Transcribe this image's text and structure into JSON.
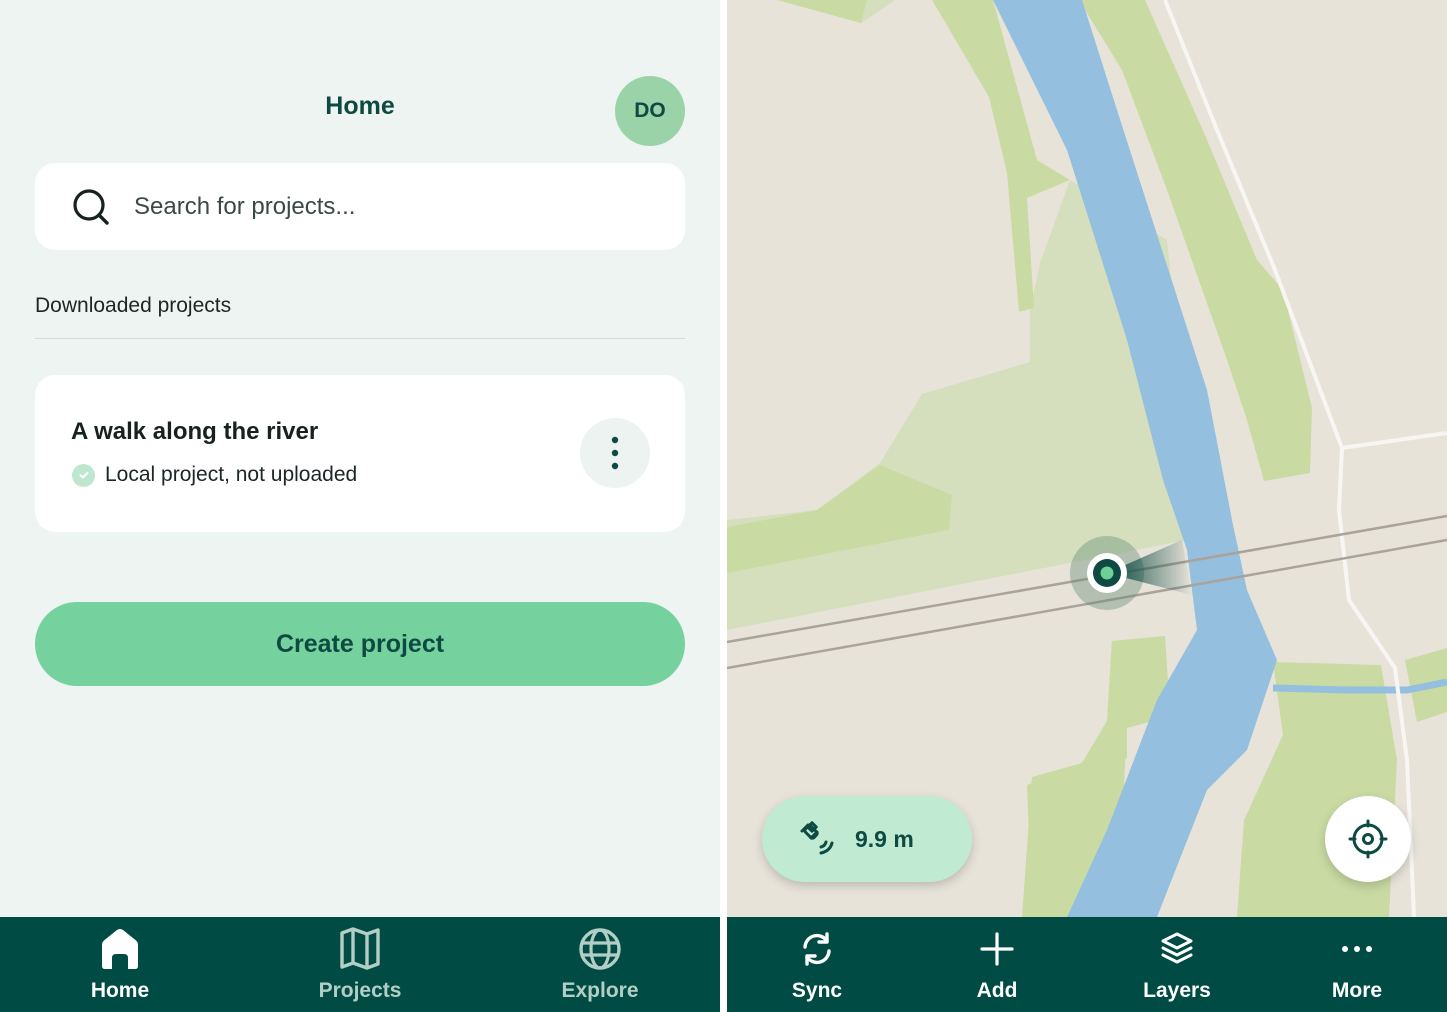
{
  "home": {
    "header": {
      "title": "Home",
      "avatar_initials": "DO"
    },
    "search": {
      "placeholder": "Search for projects...",
      "value": ""
    },
    "section_label": "Downloaded projects",
    "projects": [
      {
        "title": "A walk along the river",
        "status": "Local project, not uploaded"
      }
    ],
    "create_button_label": "Create project",
    "nav": [
      {
        "label": "Home",
        "icon": "home-icon",
        "active": true
      },
      {
        "label": "Projects",
        "icon": "map-icon",
        "active": false
      },
      {
        "label": "Explore",
        "icon": "globe-icon",
        "active": false
      }
    ]
  },
  "map": {
    "gps": {
      "icon": "satellite-icon",
      "accuracy": "9.9 m"
    },
    "locate_icon": "crosshair-icon",
    "toolbar": [
      {
        "label": "Sync",
        "icon": "sync-icon"
      },
      {
        "label": "Add",
        "icon": "plus-icon"
      },
      {
        "label": "Layers",
        "icon": "layers-icon"
      },
      {
        "label": "More",
        "icon": "more-horizontal-icon"
      }
    ]
  },
  "colors": {
    "brand_dark": "#004c45",
    "brand_green": "#75d19d",
    "avatar_bg": "#9bd3a8",
    "page_bg": "#eef4f1",
    "map_land": "#e7e3d9",
    "map_green": "#c9dba3",
    "map_light_green": "#d5dfbd",
    "map_water": "#94bfdf"
  }
}
